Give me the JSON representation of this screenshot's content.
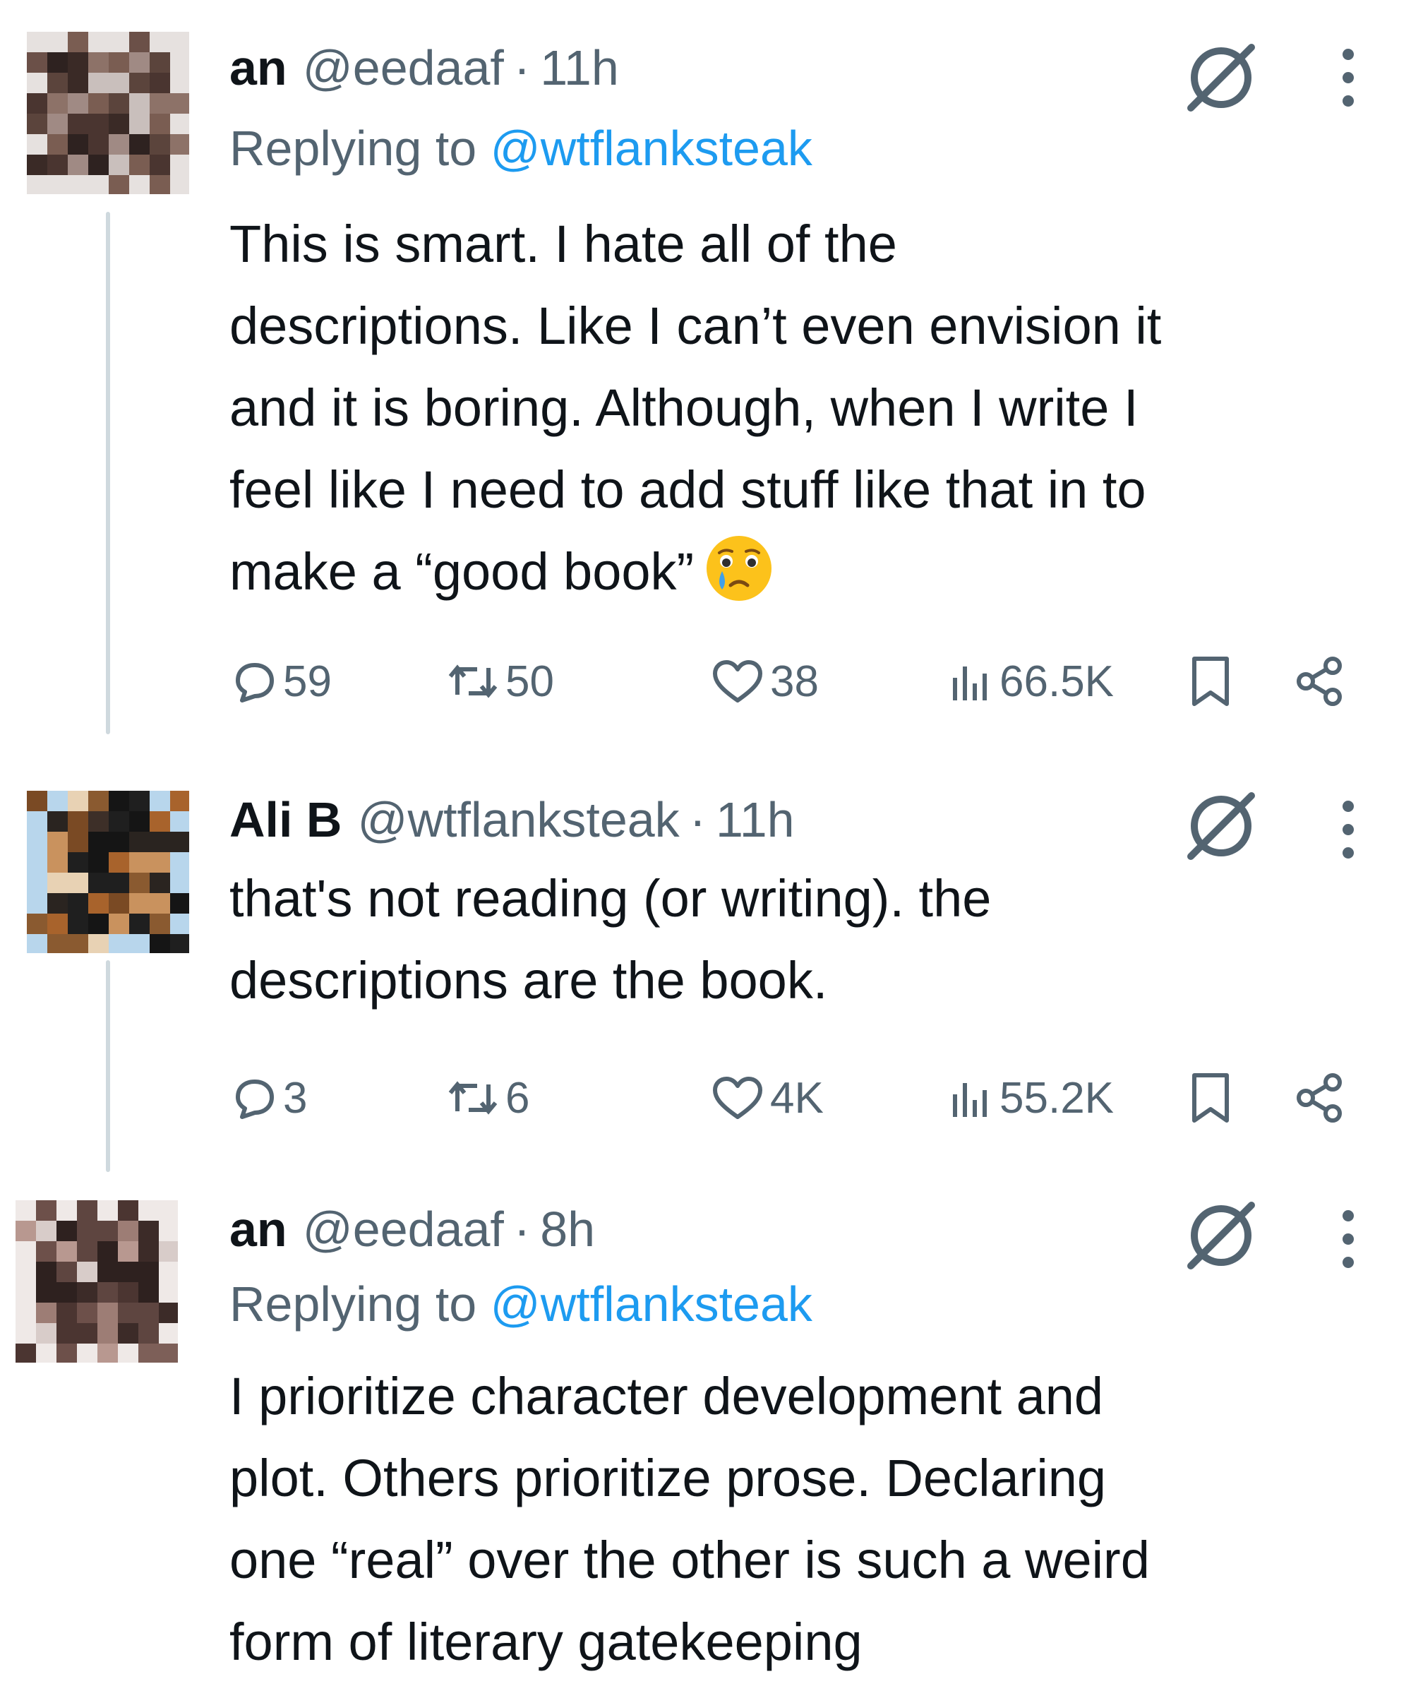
{
  "colors": {
    "text": "#0f1419",
    "muted": "#536471",
    "link": "#1d9bf0",
    "thread_line": "#cfd9de",
    "emoji_face": "#fcc21b",
    "emoji_tear": "#40a0e8"
  },
  "tweets": [
    {
      "name": "an",
      "handle": "@eedaaf",
      "separator": "·",
      "time": "11h",
      "reply_prefix": "Replying to ",
      "reply_mention": "@wtflanksteak",
      "lines": [
        "This is smart. I hate all of the",
        "descriptions. Like I can’t even envision it",
        "and it is boring. Although, when I write I",
        "feel like I need to add stuff like that in to",
        "make a “good book”"
      ],
      "emoji": "crying-face-emoji",
      "replies": "59",
      "reposts": "50",
      "likes": "38",
      "views": "66.5K",
      "icons": [
        "grok-icon",
        "more-icon",
        "reply-icon",
        "repost-icon",
        "like-icon",
        "views-icon",
        "bookmark-icon",
        "share-icon"
      ]
    },
    {
      "name": "Ali B",
      "handle": "@wtflanksteak",
      "separator": "·",
      "time": "11h",
      "lines": [
        "that's not reading (or writing). the",
        "descriptions are the book."
      ],
      "replies": "3",
      "reposts": "6",
      "likes": "4K",
      "views": "55.2K",
      "icons": [
        "grok-icon",
        "more-icon",
        "reply-icon",
        "repost-icon",
        "like-icon",
        "views-icon",
        "bookmark-icon",
        "share-icon"
      ]
    },
    {
      "name": "an",
      "handle": "@eedaaf",
      "separator": "·",
      "time": "8h",
      "reply_prefix": "Replying to ",
      "reply_mention": "@wtflanksteak",
      "lines": [
        "I prioritize character development and",
        "plot. Others prioritize prose. Declaring",
        "one “real” over the other is such a weird",
        "form of literary gatekeeping"
      ],
      "icons": [
        "grok-icon",
        "more-icon"
      ]
    }
  ]
}
